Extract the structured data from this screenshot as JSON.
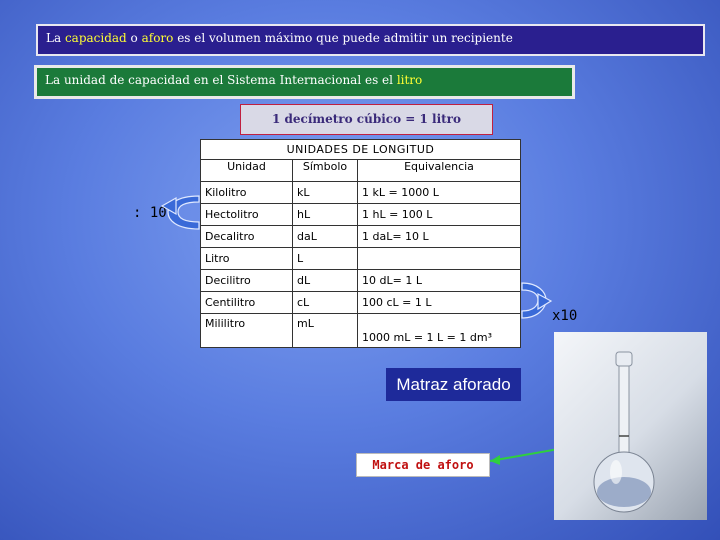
{
  "definition": {
    "before": "La ",
    "term1": "capacidad",
    "mid1": " o ",
    "term2": "aforo",
    "after": " es el volumen máximo que puede admitir un recipiente"
  },
  "si_unit": {
    "text": "La unidad de capacidad en el Sistema Internacional es el ",
    "highlight": "litro"
  },
  "equivalence": "1 decímetro cúbico = 1 litro",
  "table": {
    "title": "UNIDADES DE LONGITUD",
    "headers": [
      "Unidad",
      "Símbolo",
      "Equivalencia"
    ],
    "rows": [
      [
        "Kilolitro",
        "kL",
        "1 kL = 1000 L"
      ],
      [
        "Hectolitro",
        "hL",
        "1 hL = 100 L"
      ],
      [
        "Decalitro",
        "daL",
        "1 daL= 10 L"
      ],
      [
        "Litro",
        "L",
        ""
      ],
      [
        "Decilitro",
        "dL",
        "10 dL= 1 L"
      ],
      [
        "Centilitro",
        "cL",
        "100 cL = 1 L"
      ],
      [
        "Mililitro",
        "mL",
        "1000 mL = 1 L = 1 dm³"
      ]
    ]
  },
  "divide_label": ": 10",
  "multiply_label": "x10",
  "flask_caption": "Matraz aforado",
  "mark_label": "Marca de aforo",
  "colors": {
    "definition_bg": "#2a1f8f",
    "si_bg": "#1b7a3a",
    "highlight_yellow": "#ffff33",
    "arrow_fill": "#3a6ad8",
    "pointer_green": "#2fcf3f"
  },
  "icons": {
    "left_arrow": "curved-left-arrow-icon",
    "right_arrow": "curved-right-arrow-icon"
  }
}
